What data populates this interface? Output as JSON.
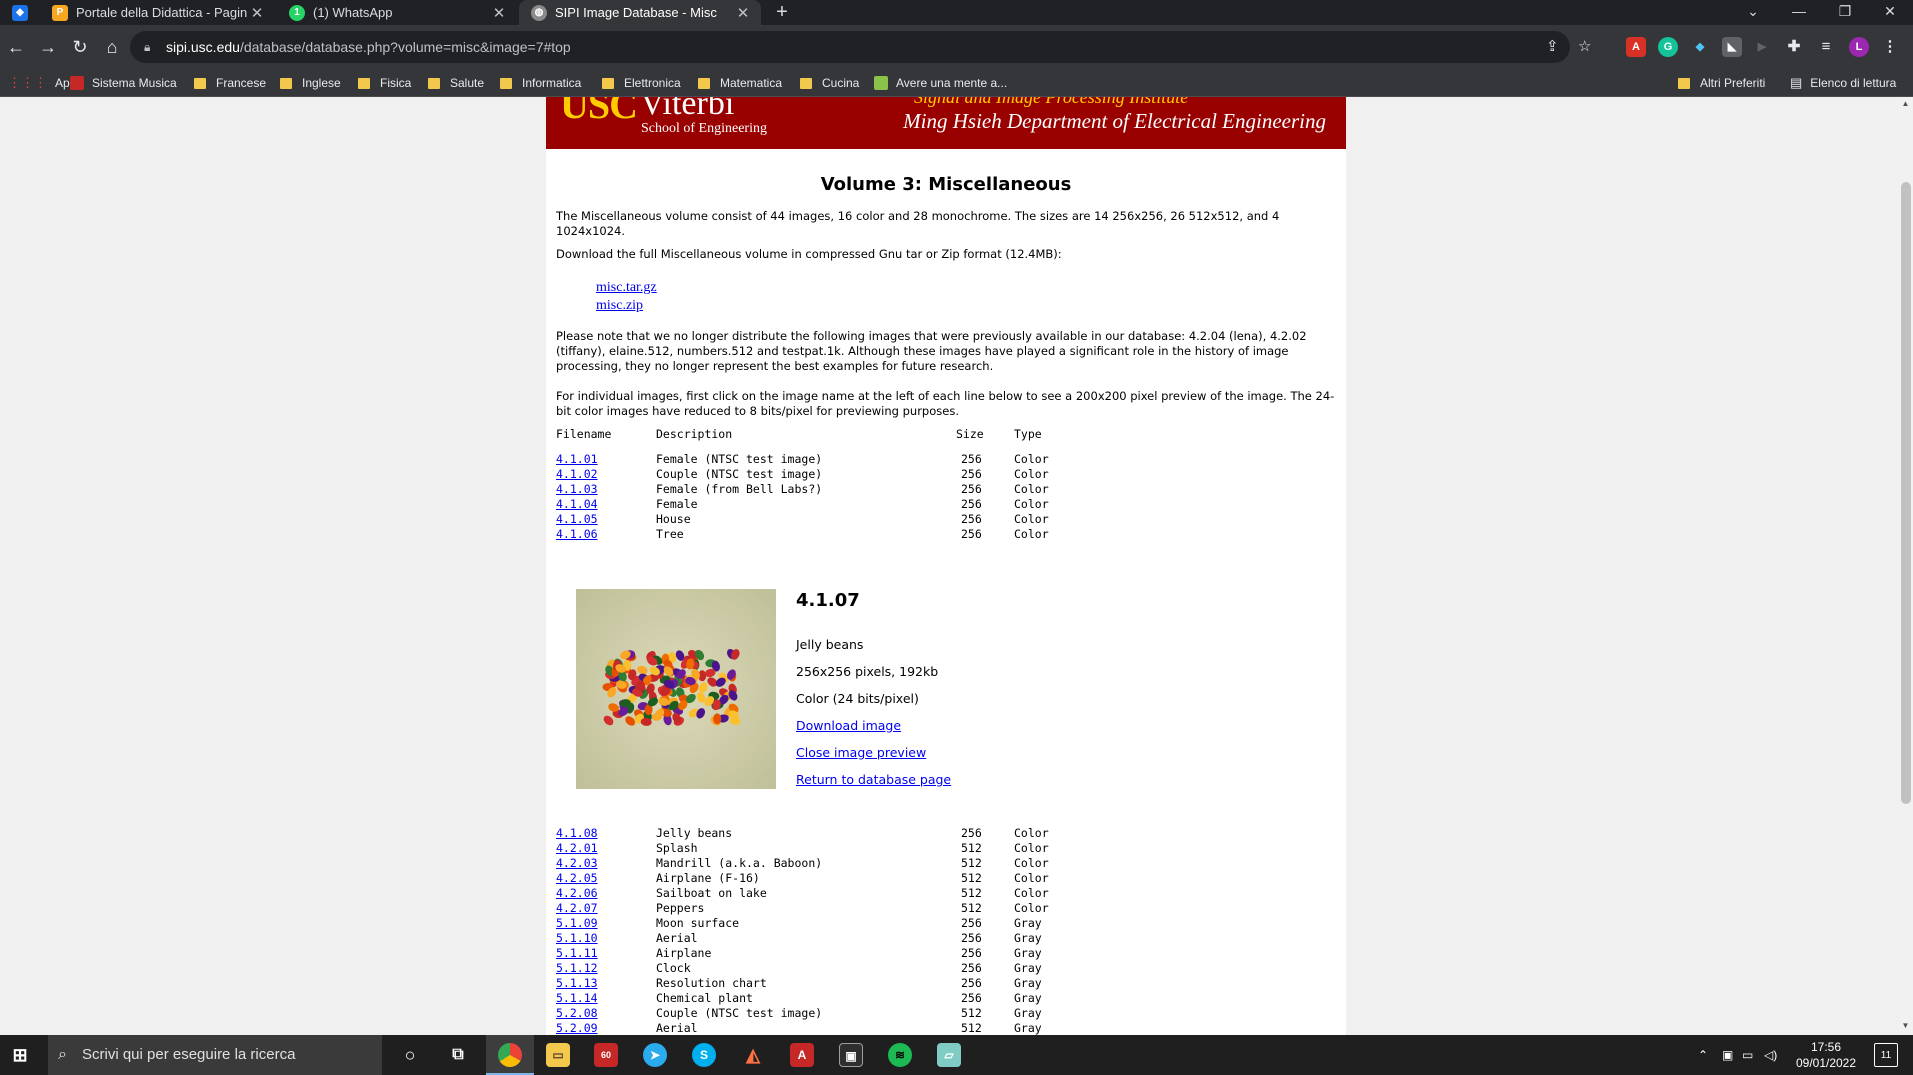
{
  "browser": {
    "tabs": [
      {
        "title": "Portale della Didattica - Pagina di",
        "icon": "portale-icon",
        "color": "#f5a623",
        "active": false
      },
      {
        "title": "(1) WhatsApp",
        "icon": "whatsapp-icon",
        "color": "#25d366",
        "active": false
      },
      {
        "title": "SIPI Image Database - Misc",
        "icon": "globe-icon",
        "color": "#8a8a8a",
        "active": true
      }
    ],
    "whatsapp_badge": "1",
    "url_host": "sipi.usc.edu",
    "url_path": "/database/database.php?volume=misc&image=7#top",
    "profile_initial": "L",
    "bookmarks": [
      {
        "label": "App",
        "type": "apps"
      },
      {
        "label": "Sistema Musica",
        "type": "site"
      },
      {
        "label": "Francese",
        "type": "folder"
      },
      {
        "label": "Inglese",
        "type": "folder"
      },
      {
        "label": "Fisica",
        "type": "folder"
      },
      {
        "label": "Salute",
        "type": "folder"
      },
      {
        "label": "Informatica",
        "type": "folder"
      },
      {
        "label": "Elettronica",
        "type": "folder"
      },
      {
        "label": "Matematica",
        "type": "folder"
      },
      {
        "label": "Cucina",
        "type": "folder"
      },
      {
        "label": "Avere una mente a...",
        "type": "site"
      }
    ],
    "other_bookmarks": "Altri Preferiti",
    "reading_list": "Elenco di lettura"
  },
  "banner": {
    "usc": "USC",
    "viterbi": "Viterbi",
    "school": "School of Engineering",
    "sipi": "Signal and Image Processing Institute",
    "dept": "Ming Hsieh Department of Electrical Engineering",
    "background": "#990000",
    "gold": "#ffcc00"
  },
  "page": {
    "title": "Volume 3: Miscellaneous",
    "intro": "The Miscellaneous volume consist of 44 images, 16 color and 28 monochrome. The sizes are 14 256x256, 26 512x512, and 4 1024x1024.",
    "download_intro": "Download the full Miscellaneous volume in compressed Gnu tar or Zip format (12.4MB):",
    "download_links": [
      "misc.tar.gz",
      "misc.zip"
    ],
    "note": "Please note that we no longer distribute the following images that were previously available in our database: 4.2.04 (lena), 4.2.02 (tiffany), elaine.512, numbers.512 and testpat.1k. Although these images have played a significant role in the history of image processing, they no longer represent the best examples for future research.",
    "instructions": "For individual images, first click on the image name at the left of each line below to see a 200x200 pixel preview of the image. The 24-bit color images have reduced to 8 bits/pixel for previewing purposes.",
    "table_headers": {
      "filename": "Filename",
      "description": "Description",
      "size": "Size",
      "type": "Type"
    },
    "rows_before": [
      {
        "file": "4.1.01",
        "desc": "Female (NTSC test image)",
        "size": "256",
        "type": "Color"
      },
      {
        "file": "4.1.02",
        "desc": "Couple (NTSC test image)",
        "size": "256",
        "type": "Color"
      },
      {
        "file": "4.1.03",
        "desc": "Female (from Bell Labs?)",
        "size": "256",
        "type": "Color"
      },
      {
        "file": "4.1.04",
        "desc": "Female",
        "size": "256",
        "type": "Color"
      },
      {
        "file": "4.1.05",
        "desc": "House",
        "size": "256",
        "type": "Color"
      },
      {
        "file": "4.1.06",
        "desc": "Tree",
        "size": "256",
        "type": "Color"
      }
    ],
    "preview": {
      "name": "4.1.07",
      "desc": "Jelly beans",
      "dims": "256x256 pixels, 192kb",
      "color": "Color (24 bits/pixel)",
      "download": "Download image",
      "close": "Close image preview",
      "back": "Return to database page"
    },
    "rows_after": [
      {
        "file": "4.1.08",
        "desc": "Jelly beans",
        "size": "256",
        "type": "Color"
      },
      {
        "file": "4.2.01",
        "desc": "Splash",
        "size": "512",
        "type": "Color"
      },
      {
        "file": "4.2.03",
        "desc": "Mandrill (a.k.a. Baboon)",
        "size": "512",
        "type": "Color"
      },
      {
        "file": "4.2.05",
        "desc": "Airplane (F-16)",
        "size": "512",
        "type": "Color"
      },
      {
        "file": "4.2.06",
        "desc": "Sailboat on lake",
        "size": "512",
        "type": "Color"
      },
      {
        "file": "4.2.07",
        "desc": "Peppers",
        "size": "512",
        "type": "Color"
      },
      {
        "file": "5.1.09",
        "desc": "Moon surface",
        "size": "256",
        "type": "Gray"
      },
      {
        "file": "5.1.10",
        "desc": "Aerial",
        "size": "256",
        "type": "Gray"
      },
      {
        "file": "5.1.11",
        "desc": "Airplane",
        "size": "256",
        "type": "Gray"
      },
      {
        "file": "5.1.12",
        "desc": "Clock",
        "size": "256",
        "type": "Gray"
      },
      {
        "file": "5.1.13",
        "desc": "Resolution chart",
        "size": "256",
        "type": "Gray"
      },
      {
        "file": "5.1.14",
        "desc": "Chemical plant",
        "size": "256",
        "type": "Gray"
      },
      {
        "file": "5.2.08",
        "desc": "Couple (NTSC test image)",
        "size": "512",
        "type": "Gray"
      },
      {
        "file": "5.2.09",
        "desc": "Aerial",
        "size": "512",
        "type": "Gray"
      }
    ]
  },
  "taskbar": {
    "search_placeholder": "Scrivi qui per eseguire la ricerca",
    "time": "17:56",
    "date": "09/01/2022",
    "notification_count": "11",
    "mail_badge": "60"
  }
}
